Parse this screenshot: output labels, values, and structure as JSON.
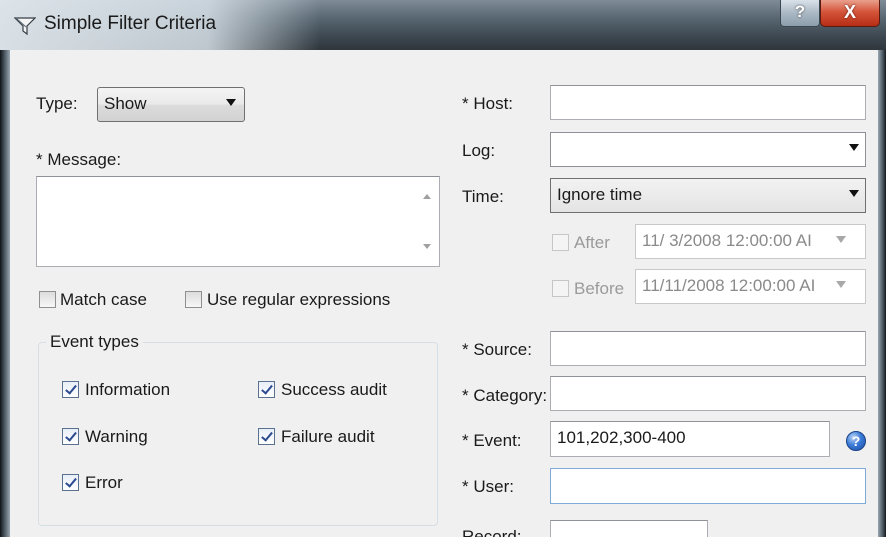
{
  "window": {
    "title": "Simple Filter Criteria",
    "help_label": "?",
    "close_label": "X"
  },
  "type": {
    "label": "Type:",
    "value": "Show"
  },
  "message": {
    "label": "* Message:",
    "value": ""
  },
  "options": {
    "match_case": {
      "label": "Match case",
      "checked": false
    },
    "use_regex": {
      "label": "Use regular expressions",
      "checked": false
    }
  },
  "event_types": {
    "title": "Event types",
    "items": [
      {
        "label": "Information",
        "checked": true
      },
      {
        "label": "Warning",
        "checked": true
      },
      {
        "label": "Error",
        "checked": true
      },
      {
        "label": "Success audit",
        "checked": true
      },
      {
        "label": "Failure audit",
        "checked": true
      }
    ]
  },
  "host": {
    "label": "* Host:",
    "value": ""
  },
  "log": {
    "label": "Log:",
    "value": ""
  },
  "time": {
    "label": "Time:",
    "value": "Ignore time"
  },
  "after": {
    "label": "After",
    "checked": false,
    "value": "11/  3/2008 12:00:00 AI"
  },
  "before": {
    "label": "Before",
    "checked": false,
    "value": "11/11/2008 12:00:00 AI"
  },
  "source": {
    "label": "* Source:",
    "value": ""
  },
  "category": {
    "label": "* Category:",
    "value": ""
  },
  "event": {
    "label": "* Event:",
    "value": "101,202,300-400",
    "help_icon_glyph": "?"
  },
  "user": {
    "label": "* User:",
    "value": ""
  },
  "record": {
    "label": "Record:"
  },
  "colors": {
    "title_bar": "#3f4a53",
    "close_button": "#c8391f",
    "dialog_background": "#f0f0f0",
    "focus_border": "#7fa9d7"
  }
}
